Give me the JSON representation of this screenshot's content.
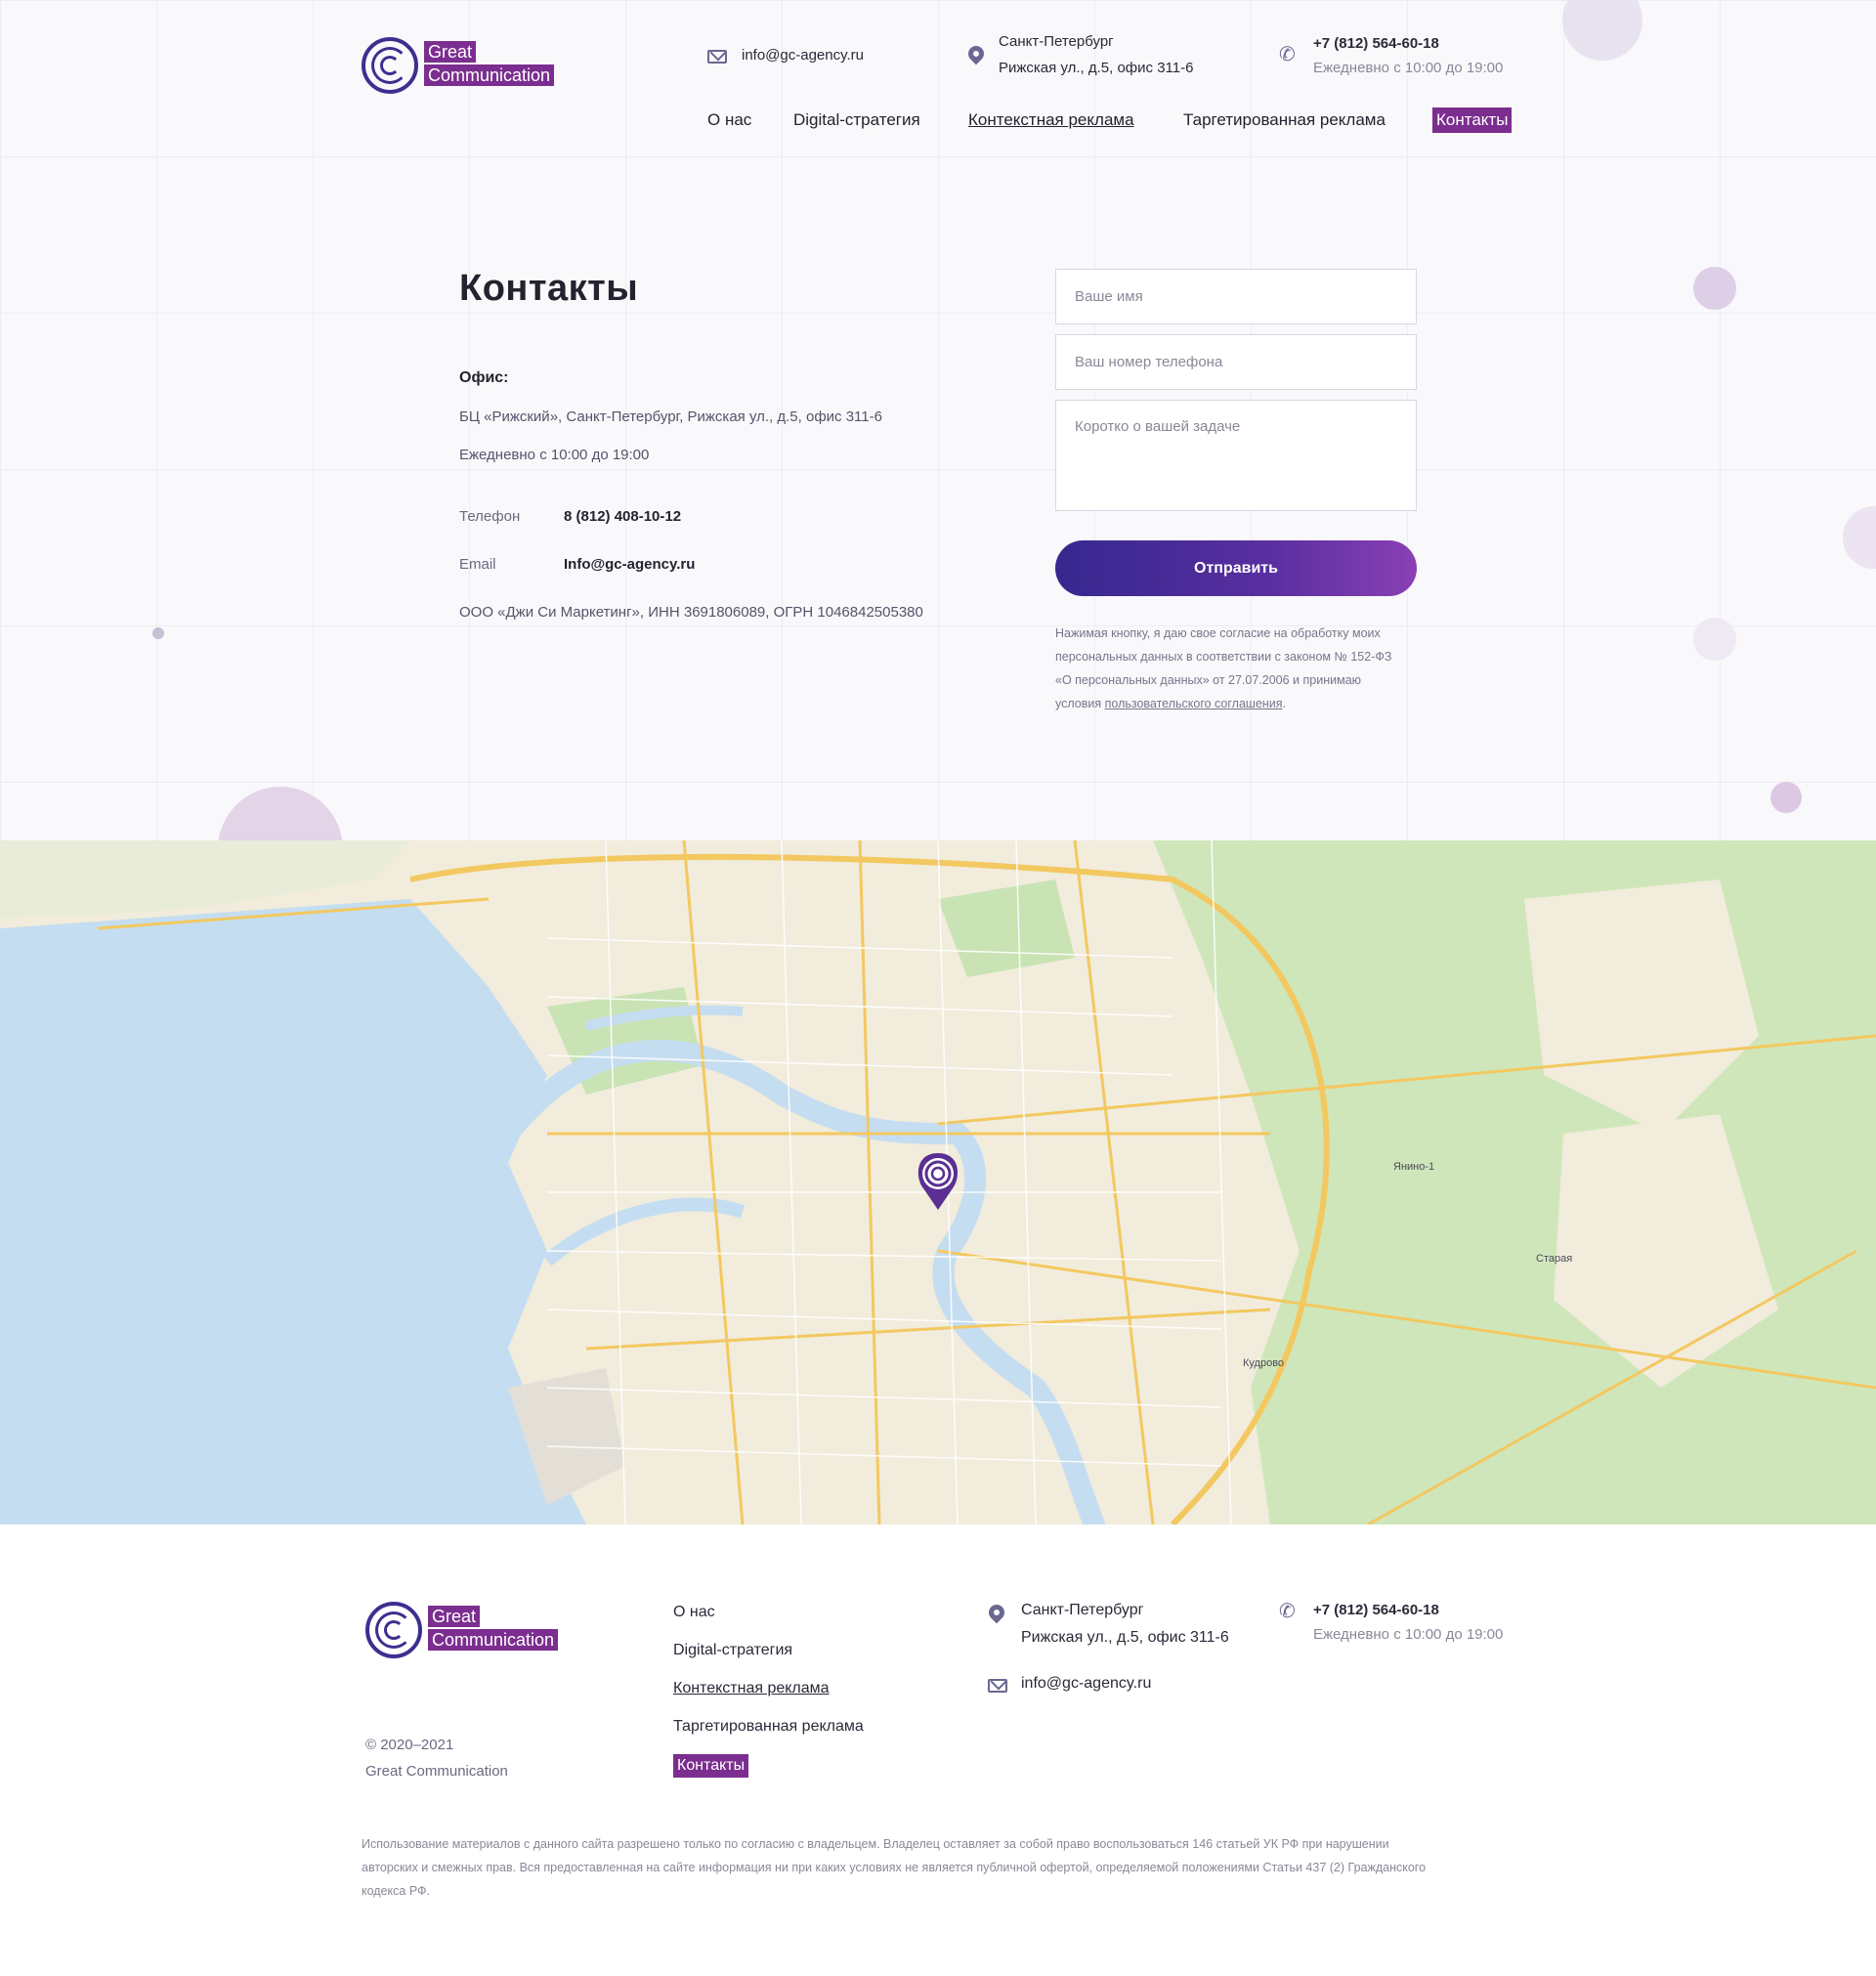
{
  "header": {
    "logo": {
      "word1": "Great",
      "word2": "Communication"
    },
    "email": "info@gc-agency.ru",
    "address_city": "Санкт-Петербург",
    "address_street": "Рижская ул., д.5, офис 311-6",
    "phone": "+7 (812) 564-60-18",
    "hours": "Ежедневно с 10:00 до 19:00",
    "icons": [
      "envelope-icon",
      "location-pin-icon",
      "phone-icon"
    ]
  },
  "nav": [
    {
      "label": "О нас",
      "state": "normal"
    },
    {
      "label": "Digital-стратегия",
      "state": "normal"
    },
    {
      "label": "Контекстная реклама",
      "state": "underlined"
    },
    {
      "label": "Таргетированная реклама",
      "state": "normal"
    },
    {
      "label": "Контакты",
      "state": "active"
    }
  ],
  "contacts": {
    "title": "Контакты",
    "office_label": "Офис:",
    "office_address": "БЦ «Рижский», Санкт-Петербург, Рижская ул., д.5, офис 311-6",
    "office_hours": "Ежедневно с 10:00 до 19:00",
    "phone_label": "Телефон",
    "phone_value": "8 (812) 408-10-12",
    "email_label": "Email",
    "email_value": "Info@gc-agency.ru",
    "company": "ООО «Джи Си Маркетинг», ИНН 3691806089, ОГРН 1046842505380"
  },
  "form": {
    "name_placeholder": "Ваше имя",
    "phone_placeholder": "Ваш номер телефона",
    "task_placeholder": "Коротко о вашей задаче",
    "submit_label": "Отправить",
    "consent_line1": "Нажимая кнопку, я даю свое согласие на обработку моих",
    "consent_line2": "персональных данных в соответствии с законом № 152-ФЗ",
    "consent_line3": "«О персональных данных» от 27.07.2006 и принимаю",
    "consent_line4_prefix": "условия ",
    "consent_link": "пользовательского соглашения",
    "consent_suffix": "."
  },
  "map": {
    "labels": [
      "Янино-1",
      "Кудрово",
      "Старая"
    ],
    "marker_icon": "map-marker-logo-icon",
    "colors": {
      "water": "#c5ddf0",
      "land": "#f1ecdc",
      "park": "#c9e3b4",
      "road": "#f3c860"
    }
  },
  "footer": {
    "logo": {
      "word1": "Great",
      "word2": "Communication"
    },
    "copyright": "© 2020–2021",
    "company": "Great Communication",
    "nav": [
      {
        "label": "О нас",
        "state": "normal"
      },
      {
        "label": "Digital-стратегия",
        "state": "normal"
      },
      {
        "label": "Контекстная реклама",
        "state": "underlined"
      },
      {
        "label": "Таргетированная реклама",
        "state": "normal"
      },
      {
        "label": "Контакты",
        "state": "active"
      }
    ],
    "address_city": "Санкт-Петербург",
    "address_street": "Рижская ул., д.5, офис 311-6",
    "email": "info@gc-agency.ru",
    "phone": "+7 (812) 564-60-18",
    "hours": "Ежедневно с 10:00 до 19:00",
    "legal_line1": "Использование материалов с данного сайта разрешено только по согласию с владельцем. Владелец оставляет за собой право воспользоваться 146 статьей УК РФ при нарушении",
    "legal_line2": "авторских и смежных прав. Вся предоставленная на сайте информация ни при каких условиях не является публичной офертой, определяемой положениями Статьи 437 (2) Гражданского",
    "legal_line3": "кодекса РФ."
  },
  "colors": {
    "accent": "#7b2e8f",
    "brand_blue": "#3d2f8f",
    "button_start": "#35288e",
    "button_end": "#8a40b4"
  }
}
